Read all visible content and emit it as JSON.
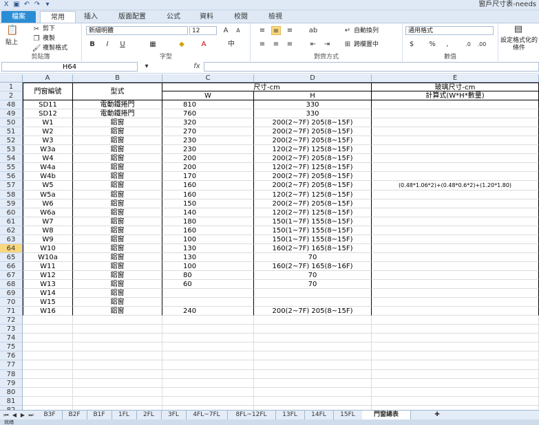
{
  "window": {
    "title": "窗戶尺寸表-needs"
  },
  "tabs": [
    "檔案",
    "常用",
    "插入",
    "版面配置",
    "公式",
    "資料",
    "校閱",
    "檢視"
  ],
  "ribbon": {
    "clipboard": {
      "paste": "貼上",
      "cut": "剪下",
      "copy": "複製",
      "format_painter": "複製格式",
      "label": "剪貼簿"
    },
    "font": {
      "name": "新細明體",
      "size": "12",
      "label": "字型"
    },
    "alignment": {
      "wrap": "自動換列",
      "merge": "跨欄置中",
      "label": "對齊方式"
    },
    "number": {
      "format": "通用格式",
      "label": "數值"
    },
    "styles": {
      "conditional": "設定格式化的條件"
    }
  },
  "formula_bar": {
    "name_box": "H64",
    "fx": "fx",
    "value": ""
  },
  "columns": [
    "A",
    "B",
    "C",
    "D",
    "E"
  ],
  "header": {
    "row1": {
      "A": "門窗編號",
      "B": "型式",
      "CD": "尺寸-cm",
      "E": "玻璃尺寸-cm"
    },
    "row2": {
      "C": "W",
      "D": "H",
      "E": "計算式(W*H*數量)"
    }
  },
  "rows": [
    {
      "n": "48",
      "A": "SD11",
      "B": "電動鐵捲門",
      "C": "810",
      "D": "330",
      "E": ""
    },
    {
      "n": "49",
      "A": "SD12",
      "B": "電動鐵捲門",
      "C": "760",
      "D": "330",
      "E": ""
    },
    {
      "n": "50",
      "A": "W1",
      "B": "鋁窗",
      "C": "320",
      "D": "200(2~7F) 205(8~15F)",
      "E": ""
    },
    {
      "n": "51",
      "A": "W2",
      "B": "鋁窗",
      "C": "270",
      "D": "200(2~7F) 205(8~15F)",
      "E": ""
    },
    {
      "n": "52",
      "A": "W3",
      "B": "鋁窗",
      "C": "230",
      "D": "200(2~7F) 205(8~15F)",
      "E": ""
    },
    {
      "n": "53",
      "A": "W3a",
      "B": "鋁窗",
      "C": "230",
      "D": "120(2~7F) 125(8~15F)",
      "E": ""
    },
    {
      "n": "54",
      "A": "W4",
      "B": "鋁窗",
      "C": "200",
      "D": "200(2~7F) 205(8~15F)",
      "E": ""
    },
    {
      "n": "55",
      "A": "W4a",
      "B": "鋁窗",
      "C": "200",
      "D": "120(2~7F) 125(8~15F)",
      "E": ""
    },
    {
      "n": "56",
      "A": "W4b",
      "B": "鋁窗",
      "C": "170",
      "D": "200(2~7F) 205(8~15F)",
      "E": ""
    },
    {
      "n": "57",
      "A": "W5",
      "B": "鋁窗",
      "C": "160",
      "D": "200(2~7F) 205(8~15F)",
      "E": "(0.48*1.06*2)+(0.48*0.6*2)+(1.20*1.80)"
    },
    {
      "n": "58",
      "A": "W5a",
      "B": "鋁窗",
      "C": "160",
      "D": "120(2~7F) 125(8~15F)",
      "E": ""
    },
    {
      "n": "59",
      "A": "W6",
      "B": "鋁窗",
      "C": "150",
      "D": "200(2~7F) 205(8~15F)",
      "E": ""
    },
    {
      "n": "60",
      "A": "W6a",
      "B": "鋁窗",
      "C": "140",
      "D": "120(2~7F) 125(8~15F)",
      "E": ""
    },
    {
      "n": "61",
      "A": "W7",
      "B": "鋁窗",
      "C": "180",
      "D": "150(1~7F) 155(8~15F)",
      "E": ""
    },
    {
      "n": "62",
      "A": "W8",
      "B": "鋁窗",
      "C": "160",
      "D": "150(1~7F) 155(8~15F)",
      "E": ""
    },
    {
      "n": "63",
      "A": "W9",
      "B": "鋁窗",
      "C": "100",
      "D": "150(1~7F) 155(8~15F)",
      "E": ""
    },
    {
      "n": "64",
      "A": "W10",
      "B": "鋁窗",
      "C": "130",
      "D": "160(2~7F) 165(8~15F)",
      "E": ""
    },
    {
      "n": "65",
      "A": "W10a",
      "B": "鋁窗",
      "C": "130",
      "D": "70",
      "E": ""
    },
    {
      "n": "66",
      "A": "W11",
      "B": "鋁窗",
      "C": "100",
      "D": "160(2~7F) 165(8~16F)",
      "E": ""
    },
    {
      "n": "67",
      "A": "W12",
      "B": "鋁窗",
      "C": "80",
      "D": "70",
      "E": ""
    },
    {
      "n": "68",
      "A": "W13",
      "B": "鋁窗",
      "C": "60",
      "D": "70",
      "E": ""
    },
    {
      "n": "69",
      "A": "W14",
      "B": "鋁窗",
      "C": "",
      "D": "",
      "E": ""
    },
    {
      "n": "70",
      "A": "W15",
      "B": "鋁窗",
      "C": "",
      "D": "",
      "E": ""
    },
    {
      "n": "71",
      "A": "W16",
      "B": "鋁窗",
      "C": "240",
      "D": "200(2~7F) 205(8~15F)",
      "E": ""
    },
    {
      "n": "72",
      "A": "",
      "B": "",
      "C": "",
      "D": "",
      "E": ""
    },
    {
      "n": "73",
      "A": "",
      "B": "",
      "C": "",
      "D": "",
      "E": ""
    },
    {
      "n": "74",
      "A": "",
      "B": "",
      "C": "",
      "D": "",
      "E": ""
    },
    {
      "n": "75",
      "A": "",
      "B": "",
      "C": "",
      "D": "",
      "E": ""
    },
    {
      "n": "76",
      "A": "",
      "B": "",
      "C": "",
      "D": "",
      "E": ""
    },
    {
      "n": "77",
      "A": "",
      "B": "",
      "C": "",
      "D": "",
      "E": ""
    },
    {
      "n": "78",
      "A": "",
      "B": "",
      "C": "",
      "D": "",
      "E": ""
    },
    {
      "n": "79",
      "A": "",
      "B": "",
      "C": "",
      "D": "",
      "E": ""
    },
    {
      "n": "80",
      "A": "",
      "B": "",
      "C": "",
      "D": "",
      "E": ""
    },
    {
      "n": "81",
      "A": "",
      "B": "",
      "C": "",
      "D": "",
      "E": ""
    },
    {
      "n": "82",
      "A": "",
      "B": "",
      "C": "",
      "D": "",
      "E": ""
    }
  ],
  "active_row": "64",
  "sheet_tabs": [
    "B3F",
    "B2F",
    "B1F",
    "1FL",
    "2FL",
    "3FL",
    "4FL~7FL",
    "8FL~12FL",
    "13FL",
    "14FL",
    "15FL",
    "門窗總表"
  ],
  "active_sheet": "門窗總表",
  "status": "就緒"
}
